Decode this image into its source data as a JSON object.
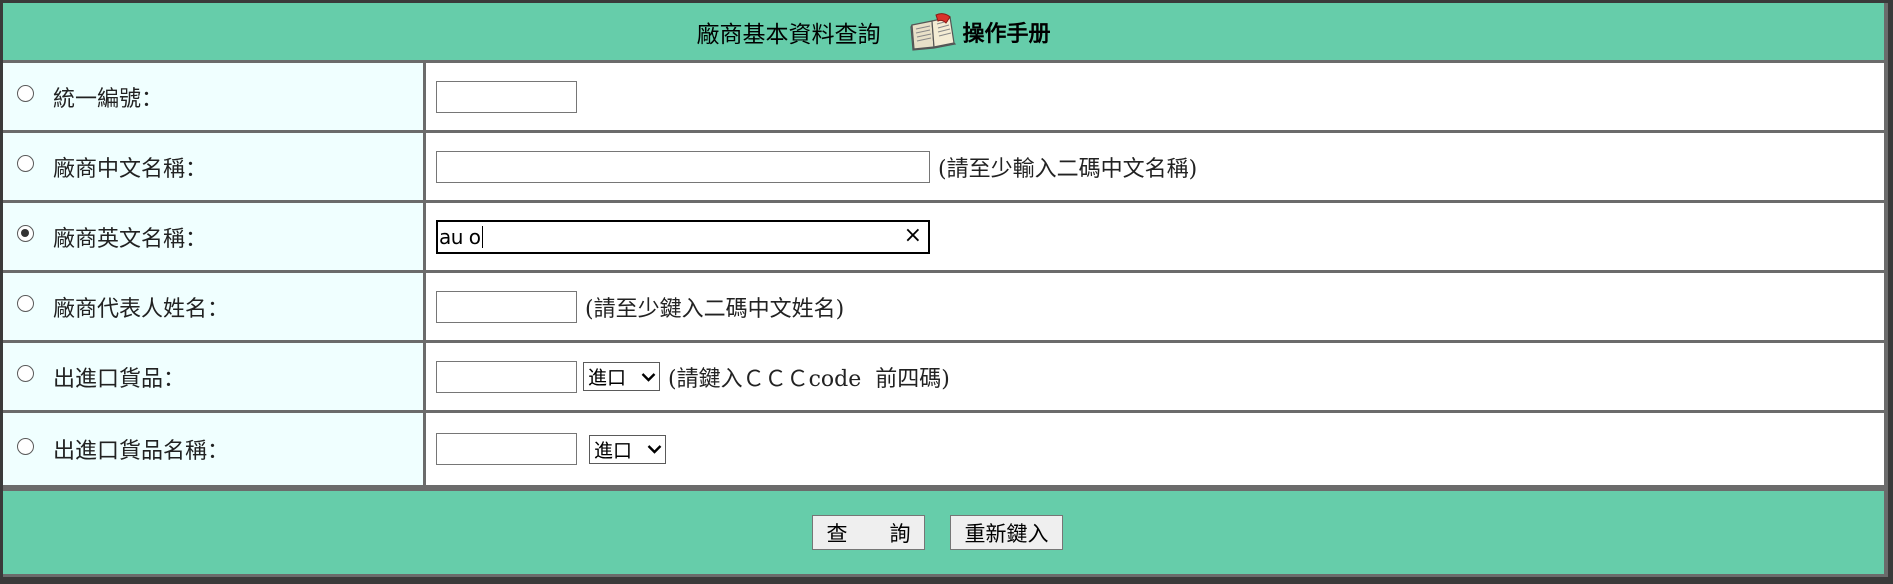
{
  "header": {
    "title": "廠商基本資料查詢",
    "manual_label": "操作手册"
  },
  "rows": [
    {
      "label": "統一編號：",
      "hint": "",
      "selected": false
    },
    {
      "label": "廠商中文名稱：",
      "hint": "(請至少輸入二碼中文名稱)",
      "selected": false
    },
    {
      "label": "廠商英文名稱：",
      "hint": "",
      "selected": true,
      "value": "au o"
    },
    {
      "label": "廠商代表人姓名：",
      "hint": "(請至少鍵入二碼中文姓名)",
      "selected": false
    },
    {
      "label": "出進口貨品：",
      "hint": "(請鍵入ＣＣＣcode  前四碼)",
      "selected": false,
      "select_value": "進口"
    },
    {
      "label": "出進口貨品名稱：",
      "hint": "",
      "selected": false,
      "select_value": "進口"
    }
  ],
  "footer": {
    "query_label": "查　　詢",
    "reset_label": "重新鍵入"
  },
  "icons": {
    "manual": "open-book-icon",
    "clear": "clear-icon",
    "dropdown": "chevron-down-icon"
  },
  "colors": {
    "header_bg": "#66cdaa",
    "label_bg": "#f0ffff",
    "border": "#6b6b6b"
  }
}
